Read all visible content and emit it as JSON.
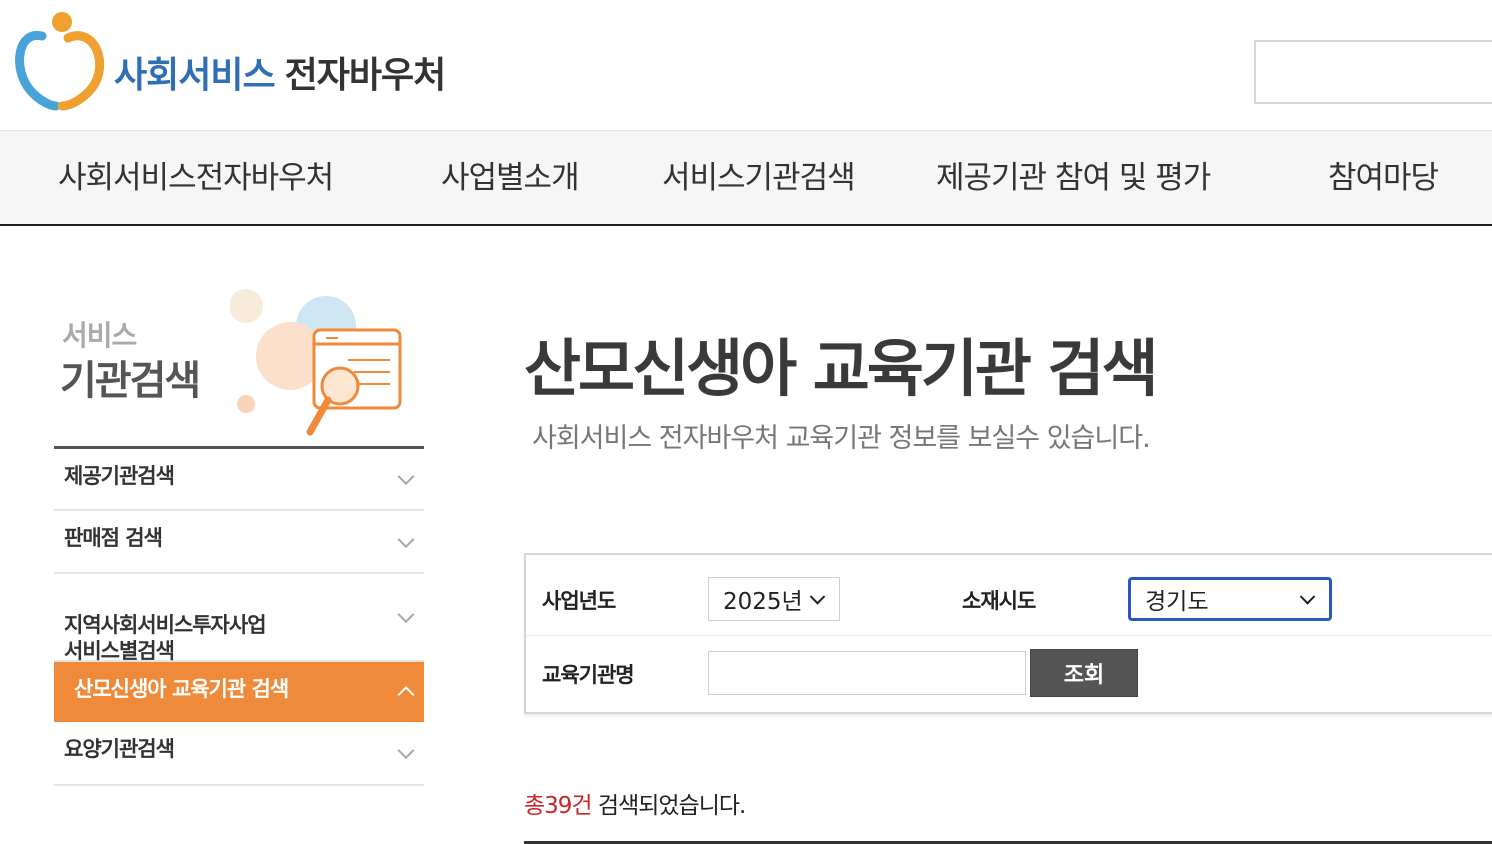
{
  "header": {
    "logo_primary": "사회서비스",
    "logo_secondary": "전자바우처",
    "search_value": ""
  },
  "gnb": {
    "items": [
      "사회서비스전자바우처",
      "사업별소개",
      "서비스기관검색",
      "제공기관 참여 및 평가",
      "참여마당"
    ]
  },
  "sidebar": {
    "banner_small": "서비스",
    "banner_big": "기관검색",
    "items": [
      {
        "label": "제공기관검색"
      },
      {
        "label": "판매점 검색"
      },
      {
        "label": "지역사회서비스투자사업\n서비스별검색"
      },
      {
        "label": "산모신생아 교육기관 검색"
      },
      {
        "label": "요양기관검색"
      }
    ]
  },
  "main": {
    "title": "산모신생아 교육기관 검색",
    "description": "사회서비스 전자바우처 교육기관 정보를 보실수 있습니다.",
    "form": {
      "year_label": "사업년도",
      "year_value": "2025년",
      "region_label": "소재시도",
      "region_value": "경기도",
      "org_label": "교육기관명",
      "org_value": "",
      "search_button": "조회"
    },
    "result_count": "총39건",
    "result_suffix": "검색되었습니다."
  },
  "colors": {
    "brand_blue": "#2f6fb6",
    "accent_orange": "#ee8a3a",
    "result_red": "#c8262b",
    "focus_blue": "#2a56c6"
  }
}
